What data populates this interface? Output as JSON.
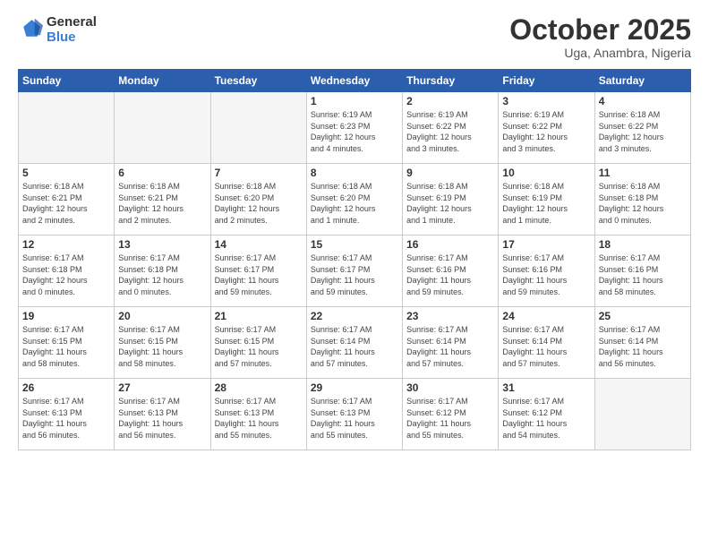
{
  "logo": {
    "line1": "General",
    "line2": "Blue"
  },
  "header": {
    "month": "October 2025",
    "location": "Uga, Anambra, Nigeria"
  },
  "weekdays": [
    "Sunday",
    "Monday",
    "Tuesday",
    "Wednesday",
    "Thursday",
    "Friday",
    "Saturday"
  ],
  "weeks": [
    [
      {
        "day": "",
        "detail": ""
      },
      {
        "day": "",
        "detail": ""
      },
      {
        "day": "",
        "detail": ""
      },
      {
        "day": "1",
        "detail": "Sunrise: 6:19 AM\nSunset: 6:23 PM\nDaylight: 12 hours\nand 4 minutes."
      },
      {
        "day": "2",
        "detail": "Sunrise: 6:19 AM\nSunset: 6:22 PM\nDaylight: 12 hours\nand 3 minutes."
      },
      {
        "day": "3",
        "detail": "Sunrise: 6:19 AM\nSunset: 6:22 PM\nDaylight: 12 hours\nand 3 minutes."
      },
      {
        "day": "4",
        "detail": "Sunrise: 6:18 AM\nSunset: 6:22 PM\nDaylight: 12 hours\nand 3 minutes."
      }
    ],
    [
      {
        "day": "5",
        "detail": "Sunrise: 6:18 AM\nSunset: 6:21 PM\nDaylight: 12 hours\nand 2 minutes."
      },
      {
        "day": "6",
        "detail": "Sunrise: 6:18 AM\nSunset: 6:21 PM\nDaylight: 12 hours\nand 2 minutes."
      },
      {
        "day": "7",
        "detail": "Sunrise: 6:18 AM\nSunset: 6:20 PM\nDaylight: 12 hours\nand 2 minutes."
      },
      {
        "day": "8",
        "detail": "Sunrise: 6:18 AM\nSunset: 6:20 PM\nDaylight: 12 hours\nand 1 minute."
      },
      {
        "day": "9",
        "detail": "Sunrise: 6:18 AM\nSunset: 6:19 PM\nDaylight: 12 hours\nand 1 minute."
      },
      {
        "day": "10",
        "detail": "Sunrise: 6:18 AM\nSunset: 6:19 PM\nDaylight: 12 hours\nand 1 minute."
      },
      {
        "day": "11",
        "detail": "Sunrise: 6:18 AM\nSunset: 6:18 PM\nDaylight: 12 hours\nand 0 minutes."
      }
    ],
    [
      {
        "day": "12",
        "detail": "Sunrise: 6:17 AM\nSunset: 6:18 PM\nDaylight: 12 hours\nand 0 minutes."
      },
      {
        "day": "13",
        "detail": "Sunrise: 6:17 AM\nSunset: 6:18 PM\nDaylight: 12 hours\nand 0 minutes."
      },
      {
        "day": "14",
        "detail": "Sunrise: 6:17 AM\nSunset: 6:17 PM\nDaylight: 11 hours\nand 59 minutes."
      },
      {
        "day": "15",
        "detail": "Sunrise: 6:17 AM\nSunset: 6:17 PM\nDaylight: 11 hours\nand 59 minutes."
      },
      {
        "day": "16",
        "detail": "Sunrise: 6:17 AM\nSunset: 6:16 PM\nDaylight: 11 hours\nand 59 minutes."
      },
      {
        "day": "17",
        "detail": "Sunrise: 6:17 AM\nSunset: 6:16 PM\nDaylight: 11 hours\nand 59 minutes."
      },
      {
        "day": "18",
        "detail": "Sunrise: 6:17 AM\nSunset: 6:16 PM\nDaylight: 11 hours\nand 58 minutes."
      }
    ],
    [
      {
        "day": "19",
        "detail": "Sunrise: 6:17 AM\nSunset: 6:15 PM\nDaylight: 11 hours\nand 58 minutes."
      },
      {
        "day": "20",
        "detail": "Sunrise: 6:17 AM\nSunset: 6:15 PM\nDaylight: 11 hours\nand 58 minutes."
      },
      {
        "day": "21",
        "detail": "Sunrise: 6:17 AM\nSunset: 6:15 PM\nDaylight: 11 hours\nand 57 minutes."
      },
      {
        "day": "22",
        "detail": "Sunrise: 6:17 AM\nSunset: 6:14 PM\nDaylight: 11 hours\nand 57 minutes."
      },
      {
        "day": "23",
        "detail": "Sunrise: 6:17 AM\nSunset: 6:14 PM\nDaylight: 11 hours\nand 57 minutes."
      },
      {
        "day": "24",
        "detail": "Sunrise: 6:17 AM\nSunset: 6:14 PM\nDaylight: 11 hours\nand 57 minutes."
      },
      {
        "day": "25",
        "detail": "Sunrise: 6:17 AM\nSunset: 6:14 PM\nDaylight: 11 hours\nand 56 minutes."
      }
    ],
    [
      {
        "day": "26",
        "detail": "Sunrise: 6:17 AM\nSunset: 6:13 PM\nDaylight: 11 hours\nand 56 minutes."
      },
      {
        "day": "27",
        "detail": "Sunrise: 6:17 AM\nSunset: 6:13 PM\nDaylight: 11 hours\nand 56 minutes."
      },
      {
        "day": "28",
        "detail": "Sunrise: 6:17 AM\nSunset: 6:13 PM\nDaylight: 11 hours\nand 55 minutes."
      },
      {
        "day": "29",
        "detail": "Sunrise: 6:17 AM\nSunset: 6:13 PM\nDaylight: 11 hours\nand 55 minutes."
      },
      {
        "day": "30",
        "detail": "Sunrise: 6:17 AM\nSunset: 6:12 PM\nDaylight: 11 hours\nand 55 minutes."
      },
      {
        "day": "31",
        "detail": "Sunrise: 6:17 AM\nSunset: 6:12 PM\nDaylight: 11 hours\nand 54 minutes."
      },
      {
        "day": "",
        "detail": ""
      }
    ]
  ]
}
